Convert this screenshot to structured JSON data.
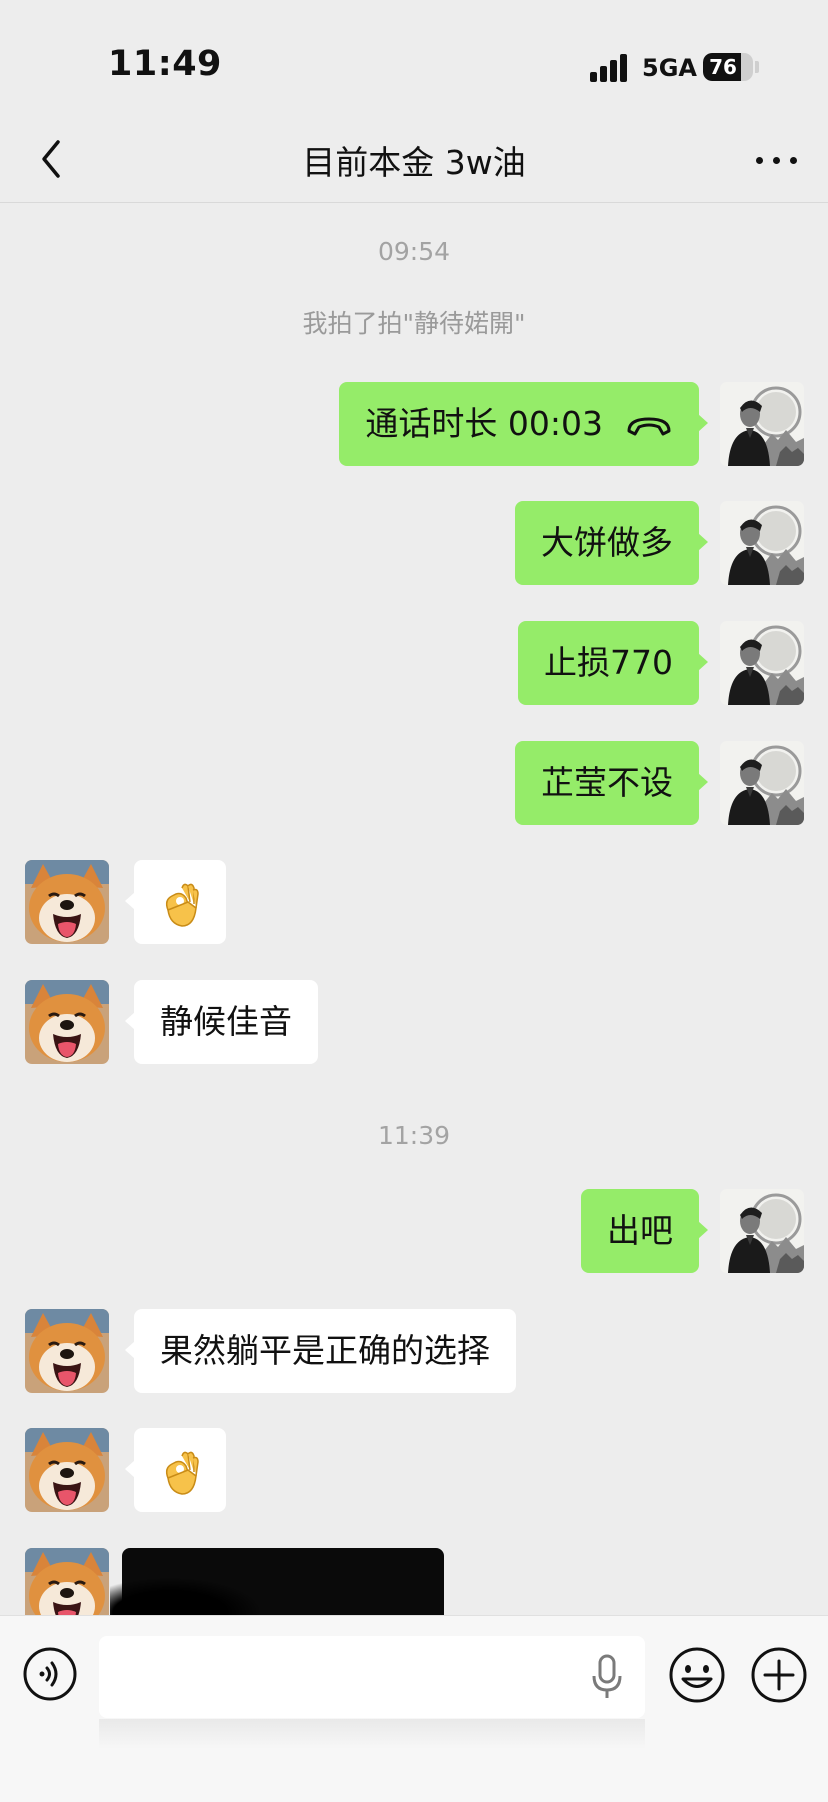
{
  "status_bar": {
    "time": "11:49",
    "network": "5GA",
    "battery": 76,
    "battery_label": "76"
  },
  "nav": {
    "title": "目前本金 3w油",
    "back_icon": "chevron-left-icon",
    "more_icon": "more-dots-icon"
  },
  "messages": {
    "time_1": "09:54",
    "system_1": "我拍了拍\"静待婼開\"",
    "m1": "通话时长 00:03",
    "m2": "大饼做多",
    "m3": "止损770",
    "m4": "芷莹不设",
    "m5_icon": "ok-hand-emoji",
    "m6": "静候佳音",
    "time_2": "11:39",
    "m7": "出吧",
    "m8": "果然躺平是正确的选择",
    "m9_icon": "ok-hand-emoji"
  },
  "input_bar": {
    "voice_icon": "voice-input-icon",
    "mic_icon": "microphone-icon",
    "emoji_icon": "emoji-icon",
    "plus_icon": "plus-icon"
  },
  "colors": {
    "background": "#ededed",
    "bubble_out": "#95ec69",
    "bubble_in": "#ffffff",
    "timestamp": "#a3a3a3"
  }
}
